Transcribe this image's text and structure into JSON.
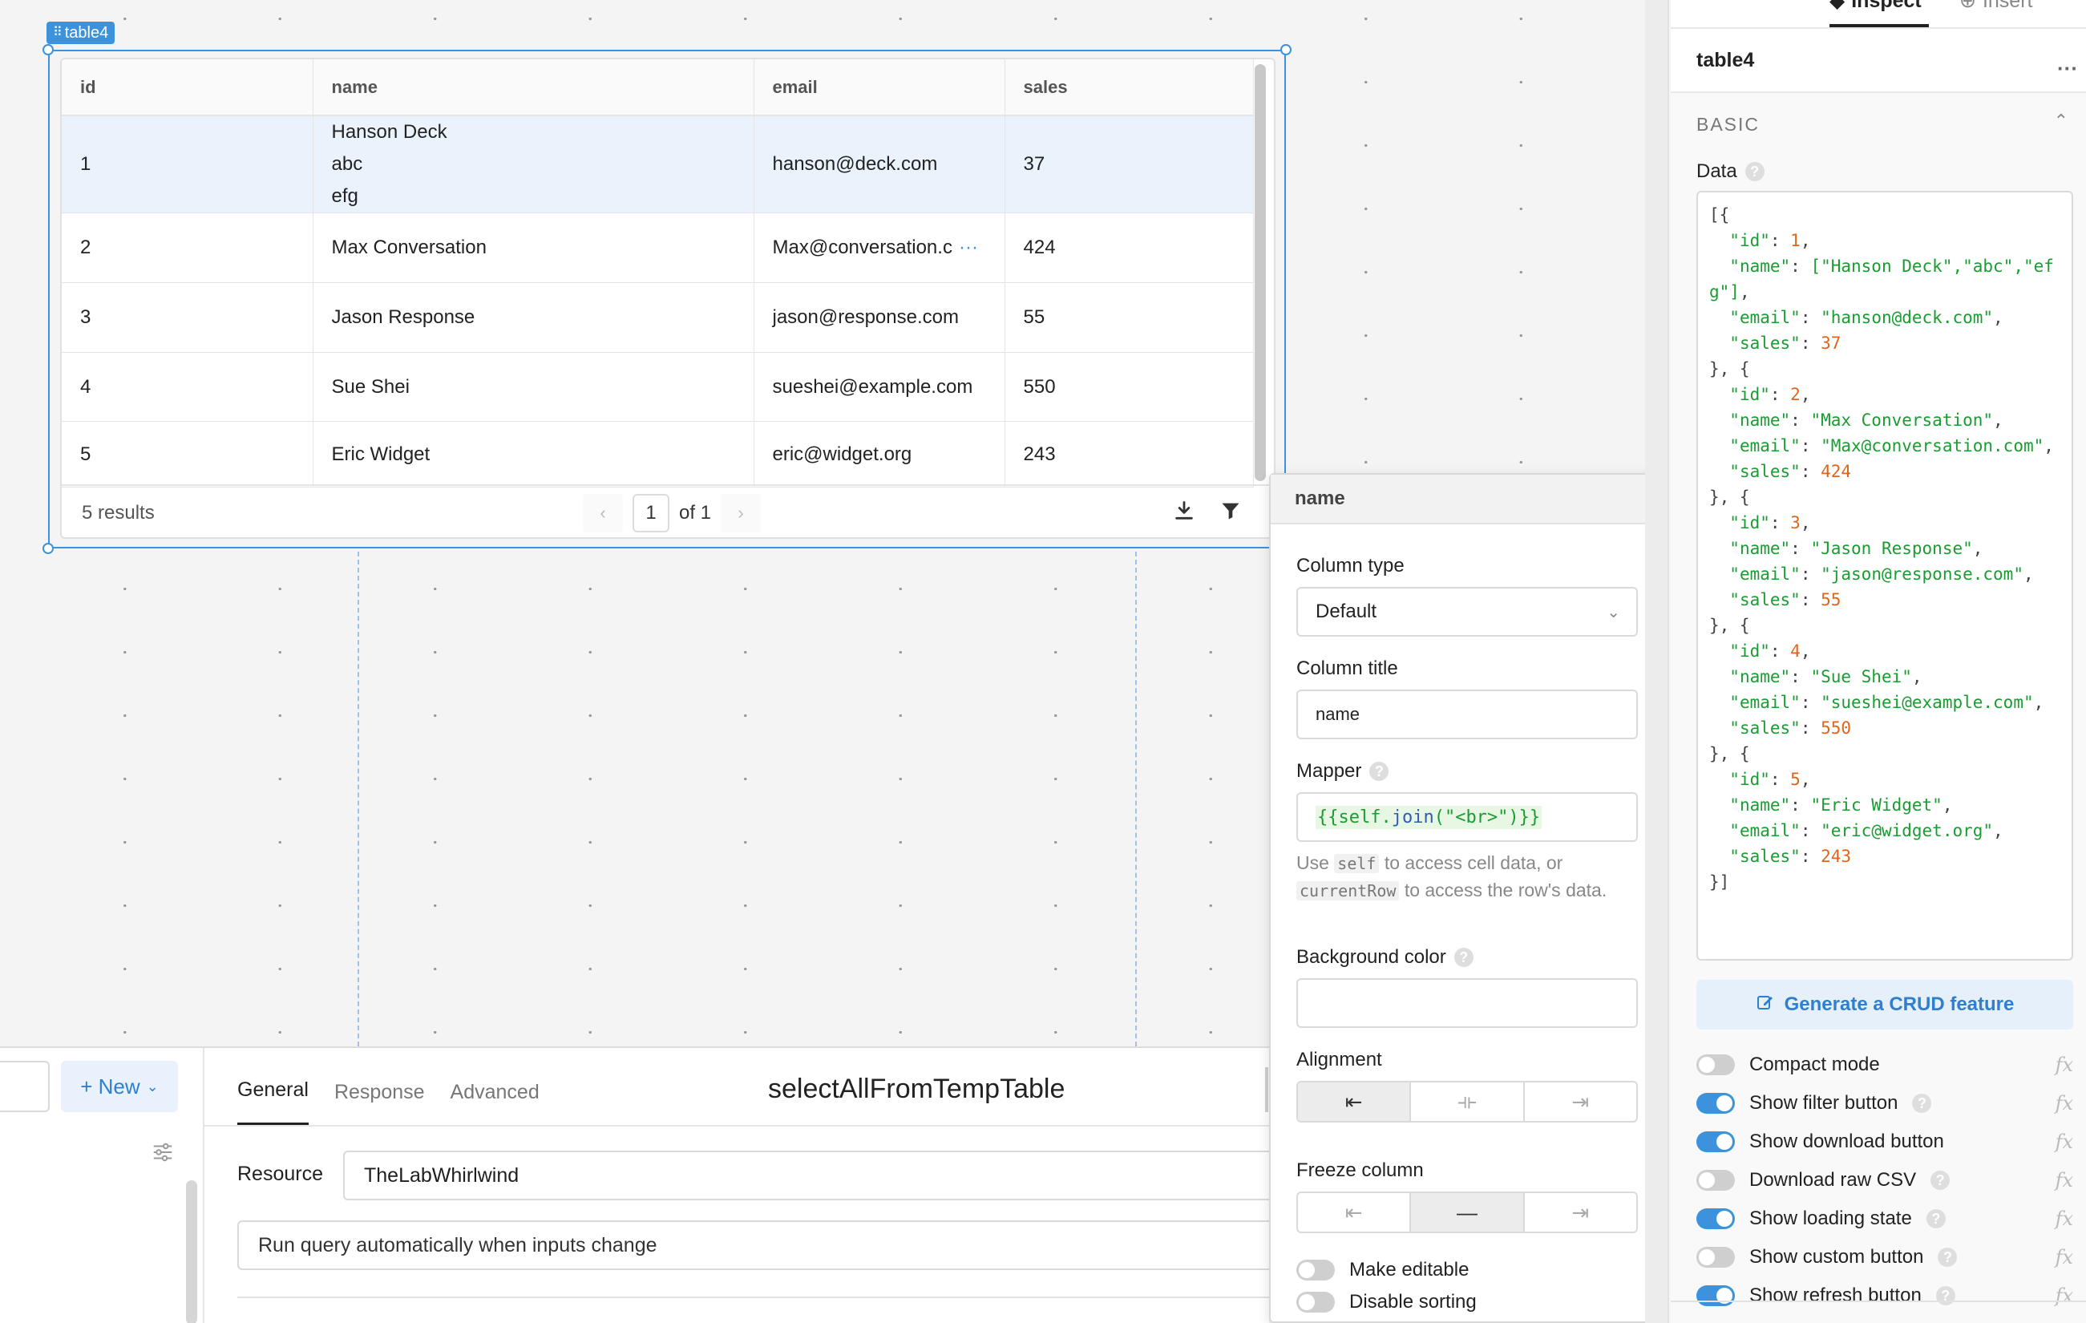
{
  "widget": {
    "tag": "table4",
    "columns": [
      "id",
      "name",
      "email",
      "sales"
    ],
    "rows": [
      {
        "id": "1",
        "name_lines": [
          "Hanson Deck",
          "abc",
          "efg"
        ],
        "email": "hanson@deck.com",
        "sales": "37"
      },
      {
        "id": "2",
        "name": "Max Conversation",
        "email": "Max@conversation.c",
        "sales": "424"
      },
      {
        "id": "3",
        "name": "Jason Response",
        "email": "jason@response.com",
        "sales": "55"
      },
      {
        "id": "4",
        "name": "Sue Shei",
        "email": "sueshei@example.com",
        "sales": "550"
      },
      {
        "id": "5",
        "name": "Eric Widget",
        "email": "eric@widget.org",
        "sales": "243"
      }
    ],
    "results": "5 results",
    "page_current": "1",
    "page_of": "of 1"
  },
  "column_panel": {
    "title": "name",
    "column_type_label": "Column type",
    "column_type_value": "Default",
    "column_title_label": "Column title",
    "column_title_value": "name",
    "mapper_label": "Mapper",
    "mapper_open": "{{self.",
    "mapper_fn": "join",
    "mapper_rest": "(\"<br>\")}}",
    "hint_use": "Use",
    "hint_self": "self",
    "hint_mid": "to access cell data, or",
    "hint_row": "currentRow",
    "hint_end": "to access the row's data.",
    "bg_label": "Background color",
    "alignment_label": "Alignment",
    "freeze_label": "Freeze column",
    "make_editable": "Make editable",
    "disable_sorting": "Disable sorting"
  },
  "query": {
    "new_label": "+ New",
    "tabs": [
      "General",
      "Response",
      "Advanced"
    ],
    "title": "selectAllFromTempTable",
    "resource_label": "Resource",
    "resource_value": "TheLabWhirlwind",
    "auto_run": "Run query automatically when inputs change"
  },
  "inspector": {
    "tab_inspect": "Inspect",
    "tab_insert": "Insert",
    "component": "table4",
    "section": "BASIC",
    "data_label": "Data",
    "crud_label": "Generate a CRUD feature",
    "toggles": [
      {
        "label": "Compact mode",
        "on": false,
        "help": false
      },
      {
        "label": "Show filter button",
        "on": true,
        "help": true
      },
      {
        "label": "Show download button",
        "on": true,
        "help": false
      },
      {
        "label": "Download raw CSV",
        "on": false,
        "help": true
      },
      {
        "label": "Show loading state",
        "on": true,
        "help": true
      },
      {
        "label": "Show custom button",
        "on": false,
        "help": true
      },
      {
        "label": "Show refresh button",
        "on": true,
        "help": true
      }
    ],
    "fx": "fx"
  },
  "data_json": [
    {
      "id": 1,
      "name": "[\"Hanson Deck\",\"abc\",\"efg\"]",
      "email": "hanson@deck.com",
      "sales": 37
    },
    {
      "id": 2,
      "name": "\"Max Conversation\"",
      "email": "Max@conversation.com",
      "sales": 424
    },
    {
      "id": 3,
      "name": "\"Jason Response\"",
      "email": "jason@response.com",
      "sales": 55
    },
    {
      "id": 4,
      "name": "\"Sue Shei\"",
      "email": "sueshei@example.com",
      "sales": 550
    },
    {
      "id": 5,
      "name": "\"Eric Widget\"",
      "email": "eric@widget.org",
      "sales": 243
    }
  ],
  "colors": {
    "accent": "#3c92dc",
    "string": "#1a9c33",
    "number": "#e0651b"
  }
}
